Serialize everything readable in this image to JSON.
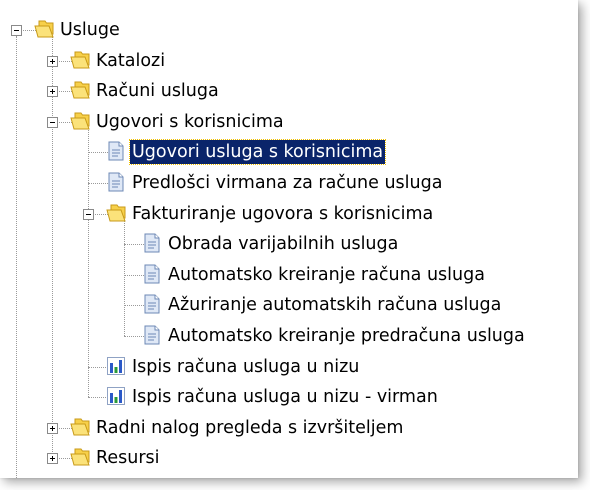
{
  "tree": {
    "nodes": [
      {
        "label": "Usluge",
        "icon": "folder-icon",
        "expander": "minus",
        "level": 0
      },
      {
        "label": "Katalozi",
        "icon": "folder-icon",
        "expander": "plus",
        "level": 1
      },
      {
        "label": "Računi usluga",
        "icon": "folder-icon",
        "expander": "plus",
        "level": 1
      },
      {
        "label": "Ugovori s korisnicima",
        "icon": "folder-icon",
        "expander": "minus",
        "level": 1
      },
      {
        "label": "Ugovori usluga s korisnicima",
        "icon": "document-icon",
        "expander": "none",
        "level": 2,
        "selected": true
      },
      {
        "label": "Predlošci virmana za račune usluga",
        "icon": "document-icon",
        "expander": "none",
        "level": 2
      },
      {
        "label": "Fakturiranje ugovora s korisnicima",
        "icon": "folder-icon",
        "expander": "minus",
        "level": 2
      },
      {
        "label": "Obrada varijabilnih usluga",
        "icon": "document-icon",
        "expander": "none",
        "level": 3
      },
      {
        "label": "Automatsko kreiranje računa usluga",
        "icon": "document-icon",
        "expander": "none",
        "level": 3
      },
      {
        "label": "Ažuriranje automatskih računa usluga",
        "icon": "document-icon",
        "expander": "none",
        "level": 3
      },
      {
        "label": "Automatsko kreiranje predračuna usluga",
        "icon": "document-icon",
        "expander": "none",
        "level": 3
      },
      {
        "label": "Ispis računa usluga u nizu",
        "icon": "report-icon",
        "expander": "none",
        "level": 2
      },
      {
        "label": "Ispis računa usluga u nizu - virman",
        "icon": "report-icon",
        "expander": "none",
        "level": 2
      },
      {
        "label": "Radni nalog pregleda s izvršiteljem",
        "icon": "folder-icon",
        "expander": "plus",
        "level": 1
      },
      {
        "label": "Resursi",
        "icon": "folder-icon",
        "expander": "plus",
        "level": 1
      }
    ]
  },
  "colors": {
    "selection_bg": "#0a246a",
    "selection_text": "#ffffff",
    "folder_fill": "#f7d04a",
    "folder_dark": "#c89a18",
    "document_fill": "#dfe8f6",
    "document_border": "#6d88b5",
    "report_bar_blue": "#2a58c8",
    "report_bar_green": "#2a9a3a"
  }
}
